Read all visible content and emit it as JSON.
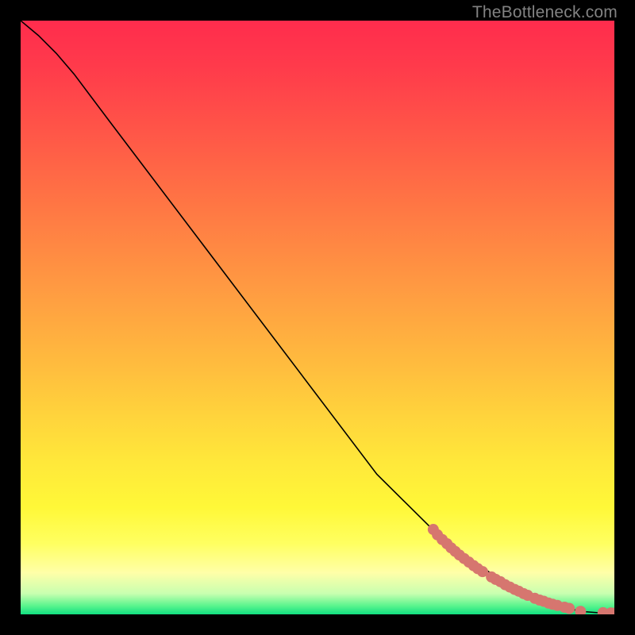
{
  "watermark": "TheBottleneck.com",
  "chart_data": {
    "type": "line",
    "title": "",
    "xlabel": "",
    "ylabel": "",
    "xlim": [
      0,
      100
    ],
    "ylim": [
      0,
      100
    ],
    "grid": false,
    "legend": false,
    "curve": [
      {
        "x": 0,
        "y": 100
      },
      {
        "x": 3,
        "y": 97.5
      },
      {
        "x": 6,
        "y": 94.5
      },
      {
        "x": 9,
        "y": 91.0
      },
      {
        "x": 12,
        "y": 87.0
      },
      {
        "x": 15,
        "y": 83.0
      },
      {
        "x": 20,
        "y": 76.4
      },
      {
        "x": 30,
        "y": 63.2
      },
      {
        "x": 40,
        "y": 50.0
      },
      {
        "x": 50,
        "y": 36.8
      },
      {
        "x": 60,
        "y": 23.6
      },
      {
        "x": 70,
        "y": 13.7
      },
      {
        "x": 75,
        "y": 9.8
      },
      {
        "x": 80,
        "y": 6.4
      },
      {
        "x": 85,
        "y": 3.6
      },
      {
        "x": 90,
        "y": 1.6
      },
      {
        "x": 93,
        "y": 0.8
      },
      {
        "x": 95,
        "y": 0.45
      },
      {
        "x": 97,
        "y": 0.3
      },
      {
        "x": 99,
        "y": 0.3
      },
      {
        "x": 100,
        "y": 0.3
      }
    ],
    "points": {
      "color": "#d6766f",
      "radius_px": 7,
      "values": [
        {
          "x": 69.5,
          "y": 14.3
        },
        {
          "x": 70.2,
          "y": 13.4
        },
        {
          "x": 71.0,
          "y": 12.6
        },
        {
          "x": 71.8,
          "y": 11.9
        },
        {
          "x": 72.5,
          "y": 11.2
        },
        {
          "x": 73.2,
          "y": 10.6
        },
        {
          "x": 73.9,
          "y": 10.0
        },
        {
          "x": 74.7,
          "y": 9.4
        },
        {
          "x": 75.5,
          "y": 8.8
        },
        {
          "x": 76.3,
          "y": 8.2
        },
        {
          "x": 77.0,
          "y": 7.7
        },
        {
          "x": 77.8,
          "y": 7.2
        },
        {
          "x": 79.3,
          "y": 6.3
        },
        {
          "x": 80.0,
          "y": 5.9
        },
        {
          "x": 80.8,
          "y": 5.5
        },
        {
          "x": 81.6,
          "y": 5.0
        },
        {
          "x": 82.4,
          "y": 4.6
        },
        {
          "x": 83.2,
          "y": 4.2
        },
        {
          "x": 83.9,
          "y": 3.9
        },
        {
          "x": 84.7,
          "y": 3.5
        },
        {
          "x": 85.4,
          "y": 3.2
        },
        {
          "x": 86.6,
          "y": 2.7
        },
        {
          "x": 87.4,
          "y": 2.4
        },
        {
          "x": 88.1,
          "y": 2.2
        },
        {
          "x": 88.9,
          "y": 1.9
        },
        {
          "x": 89.6,
          "y": 1.7
        },
        {
          "x": 90.4,
          "y": 1.5
        },
        {
          "x": 91.6,
          "y": 1.2
        },
        {
          "x": 92.4,
          "y": 1.0
        },
        {
          "x": 94.3,
          "y": 0.5
        },
        {
          "x": 98.1,
          "y": 0.28
        },
        {
          "x": 99.4,
          "y": 0.23
        },
        {
          "x": 99.9,
          "y": 0.18
        }
      ]
    },
    "green_band": {
      "y_center": 0.0,
      "half_height": 0.3
    },
    "gradient_stops": [
      {
        "offset": 0.0,
        "color": "#ff2c4d"
      },
      {
        "offset": 0.08,
        "color": "#ff3b4b"
      },
      {
        "offset": 0.18,
        "color": "#ff5448"
      },
      {
        "offset": 0.28,
        "color": "#ff6e45"
      },
      {
        "offset": 0.38,
        "color": "#ff8843"
      },
      {
        "offset": 0.48,
        "color": "#ffa241"
      },
      {
        "offset": 0.58,
        "color": "#ffbc3e"
      },
      {
        "offset": 0.66,
        "color": "#ffd23c"
      },
      {
        "offset": 0.74,
        "color": "#ffe73a"
      },
      {
        "offset": 0.82,
        "color": "#fff838"
      },
      {
        "offset": 0.88,
        "color": "#ffff60"
      },
      {
        "offset": 0.93,
        "color": "#ffffa8"
      },
      {
        "offset": 0.965,
        "color": "#c8ffb0"
      },
      {
        "offset": 0.985,
        "color": "#5df58e"
      },
      {
        "offset": 1.0,
        "color": "#11e081"
      }
    ]
  }
}
